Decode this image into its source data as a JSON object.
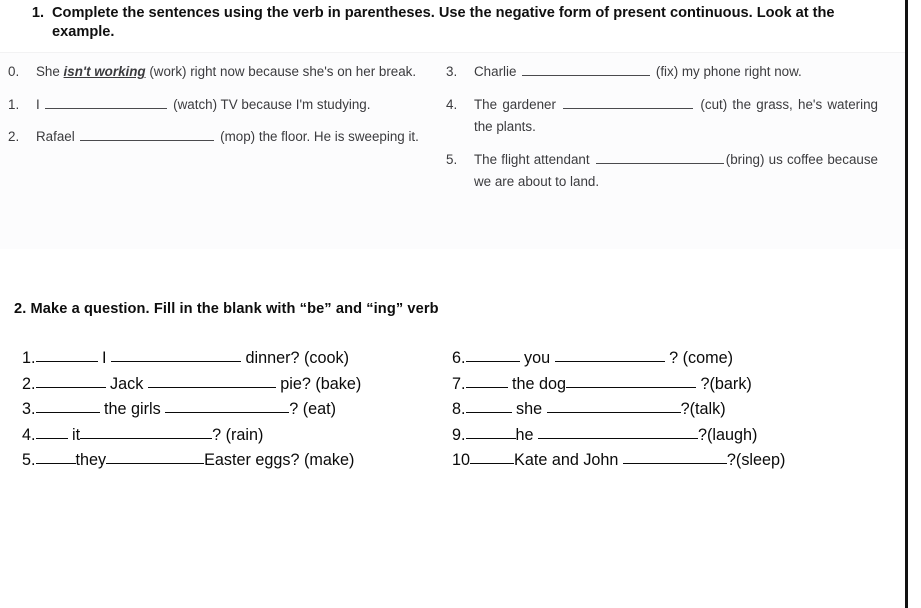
{
  "instruction_1": {
    "number": "1.",
    "text": "Complete the sentences using the verb in parentheses. Use the negative form of present continuous. Look at the example."
  },
  "exercise_1": {
    "left_items": [
      {
        "num": "0.",
        "pre": "She ",
        "answer": "isn't working",
        "post": " (work) right now because she's on her break.",
        "justify": true
      },
      {
        "num": "1.",
        "pre": "I ",
        "blank_width": 122,
        "post": " (watch) TV because I'm studying.",
        "justify": true
      },
      {
        "num": "2.",
        "pre": "Rafael ",
        "blank_width": 134,
        "post": " (mop) the floor. He is sweeping it.",
        "justify": true
      }
    ],
    "right_items": [
      {
        "num": "3.",
        "pre": "Charlie ",
        "blank_width": 128,
        "post": " (fix) my phone right now.",
        "justify": true
      },
      {
        "num": "4.",
        "pre": "The gardener ",
        "blank_width": 130,
        "post": " (cut) the grass, he's watering the plants.",
        "justify": true
      },
      {
        "num": "5.",
        "pre": "The flight attendant ",
        "blank_width": 128,
        "post": "(bring) us coffee because we are about to land.",
        "justify": true
      }
    ]
  },
  "instruction_2": {
    "text": "2. Make a question. Fill in the blank with “be” and  “ing” verb"
  },
  "exercise_2": {
    "left_items": [
      {
        "num": "1.",
        "gap1": 62,
        "mid": " I ",
        "gap2": 130,
        "tail": " dinner? (cook)"
      },
      {
        "num": "2.",
        "gap1": 70,
        "mid": " Jack ",
        "gap2": 128,
        "tail": " pie? (bake)"
      },
      {
        "num": "3.",
        "gap1": 64,
        "mid": " the girls ",
        "gap2": 124,
        "tail": "? (eat)"
      },
      {
        "num": "4.",
        "gap1": 32,
        "mid": "  it",
        "gap2": 132,
        "tail": "? (rain)"
      },
      {
        "num": "5.",
        "gap1": 40,
        "mid": "they",
        "gap2": 98,
        "tail": "Easter eggs? (make)"
      }
    ],
    "right_items": [
      {
        "num": "6.",
        "gap1": 54,
        "mid": " you ",
        "gap2": 110,
        "tail": " ? (come)"
      },
      {
        "num": "7.",
        "gap1": 42,
        "mid": " the dog",
        "gap2": 130,
        "tail": " ?(bark)"
      },
      {
        "num": "8.",
        "gap1": 46,
        "mid": " she ",
        "gap2": 134,
        "tail": "?(talk)"
      },
      {
        "num": "9.",
        "gap1": 50,
        "mid": "he ",
        "gap2": 160,
        "tail": "?(laugh)"
      },
      {
        "num": "10",
        "gap1": 44,
        "mid": "Kate and John ",
        "gap2": 104,
        "tail": "?(sleep)"
      }
    ]
  }
}
